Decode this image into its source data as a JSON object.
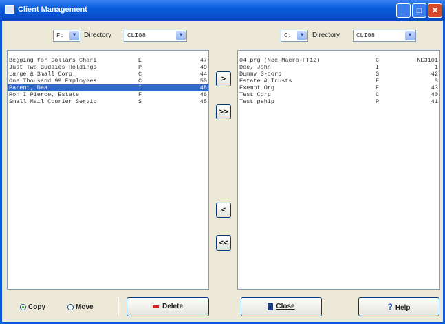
{
  "window": {
    "title": "Client Management",
    "min_glyph": "_",
    "max_glyph": "□",
    "close_glyph": "✕"
  },
  "left": {
    "drive": "F:",
    "directory_label": "Directory",
    "directory": "CLI08",
    "rows": [
      {
        "name": "Begging for Dollars Chari",
        "type": "E",
        "num": "47"
      },
      {
        "name": "Just Two Buddies Holdings",
        "type": "P",
        "num": "49"
      },
      {
        "name": "Large & Small Corp.",
        "type": "C",
        "num": "44"
      },
      {
        "name": "One Thousand 99 Employees",
        "type": "C",
        "num": "50"
      },
      {
        "name": "Parent, Dea",
        "type": "I",
        "num": "48"
      },
      {
        "name": "Ron I Pierce, Estate",
        "type": "F",
        "num": "46"
      },
      {
        "name": "Small Mail Courier Servic",
        "type": "S",
        "num": "45"
      }
    ],
    "selected_index": 4
  },
  "right": {
    "drive": "C:",
    "directory_label": "Directory",
    "directory": "CLI08",
    "rows": [
      {
        "name": "04 prg (Nee-Macro-FT12)",
        "type": "C",
        "num": "NE3101"
      },
      {
        "name": "Doe, John",
        "type": "I",
        "num": "1"
      },
      {
        "name": "Dummy S-corp",
        "type": "S",
        "num": "42"
      },
      {
        "name": "Estate & Trusts",
        "type": "F",
        "num": "3"
      },
      {
        "name": "Exempt Org",
        "type": "E",
        "num": "43"
      },
      {
        "name": "Test Corp",
        "type": "C",
        "num": "40"
      },
      {
        "name": "Test pship",
        "type": "P",
        "num": "41"
      }
    ]
  },
  "transfer": {
    "move_right": ">",
    "move_all_right": ">>",
    "move_left": "<",
    "move_all_left": "<<"
  },
  "mode": {
    "copy_label": "Copy",
    "move_label": "Move",
    "selected": "copy"
  },
  "buttons": {
    "delete": "Delete",
    "close": "Close",
    "help": "Help"
  },
  "icons": {
    "delete": "minus-icon",
    "close": "door-icon",
    "help": "question-icon",
    "dropdown": "chevron-down-icon"
  },
  "colors": {
    "titlebar": "#0A5CDB",
    "selection": "#316AC5",
    "background": "#ECE9D8"
  }
}
